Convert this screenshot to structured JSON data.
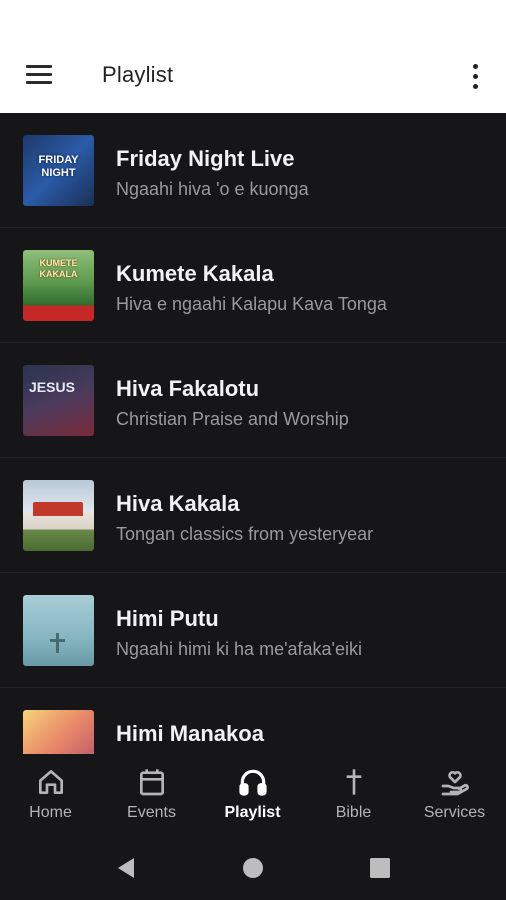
{
  "app_bar": {
    "title": "Playlist"
  },
  "playlists": [
    {
      "title": "Friday Night Live",
      "subtitle": "Ngaahi hiva 'o e kuonga",
      "thumb_text": "FRIDAY NIGHT"
    },
    {
      "title": "Kumete Kakala",
      "subtitle": "Hiva e ngaahi Kalapu Kava Tonga",
      "thumb_text": "KUMETE KAKALA"
    },
    {
      "title": "Hiva Fakalotu",
      "subtitle": "Christian Praise and Worship",
      "thumb_text": "JESUS"
    },
    {
      "title": "Hiva Kakala",
      "subtitle": "Tongan classics from yesteryear"
    },
    {
      "title": "Himi Putu",
      "subtitle": "Ngaahi himi ki ha me'afaka'eiki"
    },
    {
      "title": "Himi Manakoa",
      "subtitle": ""
    }
  ],
  "bottom_nav": {
    "items": [
      {
        "label": "Home",
        "icon": "home-icon"
      },
      {
        "label": "Events",
        "icon": "calendar-icon"
      },
      {
        "label": "Playlist",
        "icon": "headphones-icon",
        "active": true
      },
      {
        "label": "Bible",
        "icon": "cross-icon"
      },
      {
        "label": "Services",
        "icon": "hand-heart-icon"
      }
    ]
  },
  "colors": {
    "background": "#161618",
    "app_bar": "#ffffff",
    "active_nav": "#ffffff",
    "inactive_nav": "#b4b4b8"
  }
}
